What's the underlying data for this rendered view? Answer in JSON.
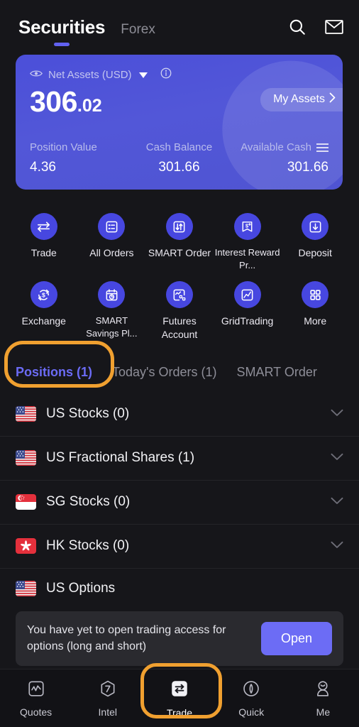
{
  "header": {
    "tab_active": "Securities",
    "tab_inactive": "Forex",
    "search_icon": "search-icon",
    "mail_icon": "mail-icon"
  },
  "balance_card": {
    "net_assets_label": "Net Assets (USD)",
    "eye_icon": "eye-icon",
    "dropdown_icon": "chevron-down-icon",
    "info_icon": "info-icon",
    "amount_integer": "306",
    "amount_decimal": ".02",
    "my_assets_label": "My Assets",
    "my_assets_chevron": "chevron-right-icon",
    "stats": [
      {
        "label": "Position Value",
        "value": "4.36"
      },
      {
        "label": "Cash Balance",
        "value": "301.66"
      },
      {
        "label": "Available Cash",
        "value": "301.66",
        "menu_icon": "hamburger-icon"
      }
    ],
    "accent_color": "#4f54d2"
  },
  "quick_actions_row1": [
    {
      "label": "Trade",
      "icon": "exchange-arrows-icon"
    },
    {
      "label": "All Orders",
      "icon": "list-document-icon"
    },
    {
      "label": "SMART Order",
      "icon": "updown-arrows-box-icon"
    },
    {
      "label": "Interest Reward Pr...",
      "icon": "dollar-reward-banner-icon"
    },
    {
      "label": "Deposit",
      "icon": "download-box-icon"
    }
  ],
  "quick_actions_row2": [
    {
      "label": "Exchange",
      "icon": "dollar-refresh-icon"
    },
    {
      "label": "SMART Savings Pl...",
      "icon": "calendar-clock-icon"
    },
    {
      "label": "Futures Account",
      "icon": "chart-nodes-icon"
    },
    {
      "label": "GridTrading",
      "icon": "grid-chart-icon"
    },
    {
      "label": "More",
      "icon": "four-squares-icon"
    }
  ],
  "tabs": [
    {
      "label": "Positions (1)",
      "active": true
    },
    {
      "label": "Today's Orders (1)",
      "active": false
    },
    {
      "label": "SMART Order",
      "active": false
    }
  ],
  "positions": [
    {
      "label": "US Stocks (0)",
      "flag": "us-flag-icon",
      "chevron": "chevron-down-icon"
    },
    {
      "label": "US Fractional Shares (1)",
      "flag": "us-flag-icon",
      "chevron": "chevron-down-icon"
    },
    {
      "label": "SG Stocks (0)",
      "flag": "sg-flag-icon",
      "chevron": "chevron-down-icon"
    },
    {
      "label": "HK Stocks (0)",
      "flag": "hk-flag-icon",
      "chevron": "chevron-down-icon"
    }
  ],
  "options_section": {
    "title": "US Options",
    "flag": "us-flag-icon",
    "banner_text": "You have yet to open trading access for options (long and short)",
    "open_button": "Open",
    "button_color": "#6c6cf5"
  },
  "bottom_nav": [
    {
      "label": "Quotes",
      "icon": "quotes-chart-icon",
      "active": false
    },
    {
      "label": "Intel",
      "icon": "intel-hexagon-icon",
      "active": false
    },
    {
      "label": "Trade",
      "icon": "trade-exchange-icon",
      "active": true
    },
    {
      "label": "Quick",
      "icon": "quick-diamond-icon",
      "active": false
    },
    {
      "label": "Me",
      "icon": "profile-person-icon",
      "active": false
    }
  ],
  "annotations": {
    "highlight_color": "#f0a030",
    "ring_positions_tab": "positions-tab-highlight",
    "ring_trade_nav": "trade-nav-highlight"
  }
}
